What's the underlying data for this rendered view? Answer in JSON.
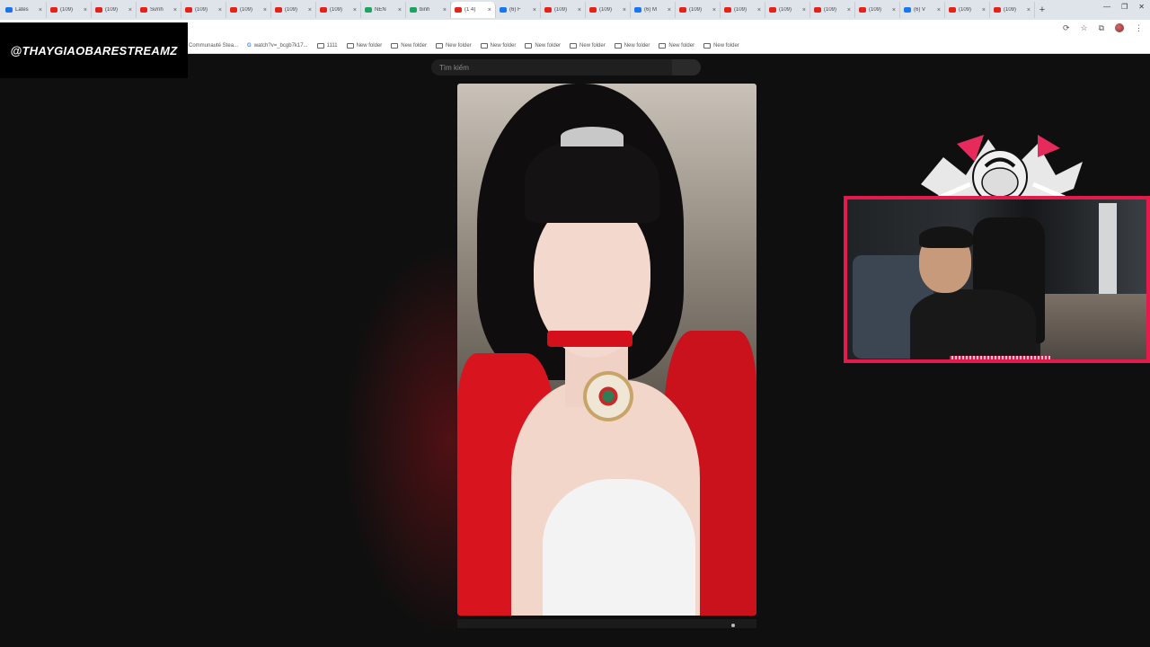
{
  "browser": {
    "tabs": [
      {
        "label": "Lates",
        "icon": "drive-icon",
        "color": "#1a73e8",
        "active": false
      },
      {
        "label": "(109)",
        "icon": "youtube-icon",
        "color": "#e62117",
        "active": false
      },
      {
        "label": "(109)",
        "icon": "youtube-icon",
        "color": "#e62117",
        "active": false
      },
      {
        "label": "Sữnh",
        "icon": "youtube-icon",
        "color": "#e62117",
        "active": false
      },
      {
        "label": "(109)",
        "icon": "youtube-icon",
        "color": "#e62117",
        "active": false
      },
      {
        "label": "(109)",
        "icon": "youtube-icon",
        "color": "#e62117",
        "active": false
      },
      {
        "label": "(109)",
        "icon": "youtube-icon",
        "color": "#e62117",
        "active": false
      },
      {
        "label": "(109)",
        "icon": "youtube-icon",
        "color": "#e62117",
        "active": false
      },
      {
        "label": "NEN",
        "icon": "drive-icon",
        "color": "#1ea362",
        "active": false
      },
      {
        "label": "binh",
        "icon": "drive-icon",
        "color": "#1ea362",
        "active": false
      },
      {
        "label": "(1 4)",
        "icon": "youtube-icon",
        "color": "#e62117",
        "active": true
      },
      {
        "label": "(6) F",
        "icon": "facebook-icon",
        "color": "#1877f2",
        "active": false
      },
      {
        "label": "(109)",
        "icon": "youtube-icon",
        "color": "#e62117",
        "active": false
      },
      {
        "label": "(109)",
        "icon": "youtube-icon",
        "color": "#e62117",
        "active": false
      },
      {
        "label": "(6) M",
        "icon": "facebook-icon",
        "color": "#1877f2",
        "active": false
      },
      {
        "label": "(109)",
        "icon": "youtube-icon",
        "color": "#e62117",
        "active": false
      },
      {
        "label": "(109)",
        "icon": "youtube-icon",
        "color": "#e62117",
        "active": false
      },
      {
        "label": "(109)",
        "icon": "youtube-icon",
        "color": "#e62117",
        "active": false
      },
      {
        "label": "(109)",
        "icon": "youtube-icon",
        "color": "#e62117",
        "active": false
      },
      {
        "label": "(109)",
        "icon": "youtube-icon",
        "color": "#e62117",
        "active": false
      },
      {
        "label": "(6) V",
        "icon": "facebook-icon",
        "color": "#1877f2",
        "active": false
      },
      {
        "label": "(109)",
        "icon": "youtube-icon",
        "color": "#e62117",
        "active": false
      },
      {
        "label": "(109)",
        "icon": "youtube-icon",
        "color": "#e62117",
        "active": false
      }
    ],
    "new_tab": "+",
    "window_controls": [
      "—",
      "❐",
      "✕"
    ],
    "bookmarks": [
      {
        "label": "Communauté Stea...",
        "type": "link"
      },
      {
        "label": "watch?v=_bcgb7k17...",
        "type": "google"
      },
      {
        "label": "1111",
        "type": "folder"
      },
      {
        "label": "New folder",
        "type": "folder"
      },
      {
        "label": "New folder",
        "type": "folder"
      },
      {
        "label": "New folder",
        "type": "folder"
      },
      {
        "label": "New folder",
        "type": "folder"
      },
      {
        "label": "New folder",
        "type": "folder"
      },
      {
        "label": "New folder",
        "type": "folder"
      },
      {
        "label": "New folder",
        "type": "folder"
      },
      {
        "label": "New folder",
        "type": "folder"
      },
      {
        "label": "New folder",
        "type": "folder"
      }
    ]
  },
  "overlay": {
    "watermark": "@THAYGIAOBARESTREAMZ"
  },
  "page": {
    "search_placeholder": "Tìm kiếm"
  },
  "colors": {
    "accent": "#e51a4c",
    "background": "#0f0f0f"
  }
}
